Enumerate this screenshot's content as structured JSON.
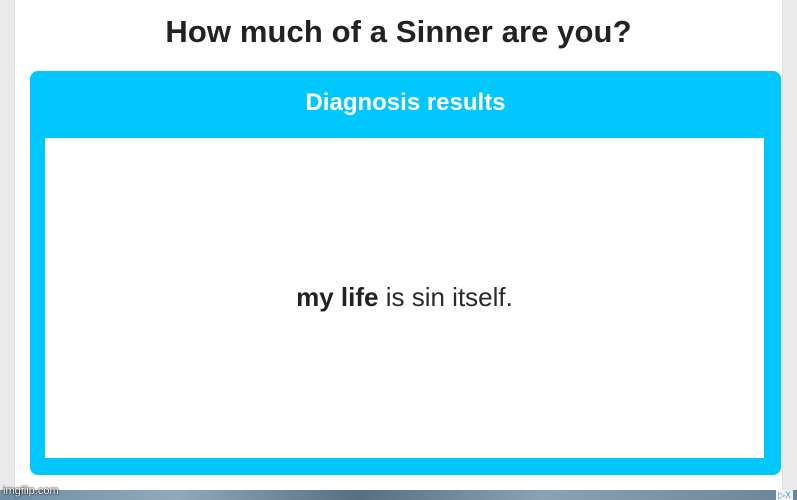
{
  "header": {
    "title": "How much of a Sinner are you?"
  },
  "result_card": {
    "header_label": "Diagnosis results",
    "result": {
      "name": "my life",
      "text": " is sin itself."
    }
  },
  "ad": {
    "badge": "▷X"
  },
  "watermark": "imgflip.com",
  "colors": {
    "card_accent": "#00c8ff",
    "page_background": "#ffffff",
    "title_text": "#222222"
  }
}
